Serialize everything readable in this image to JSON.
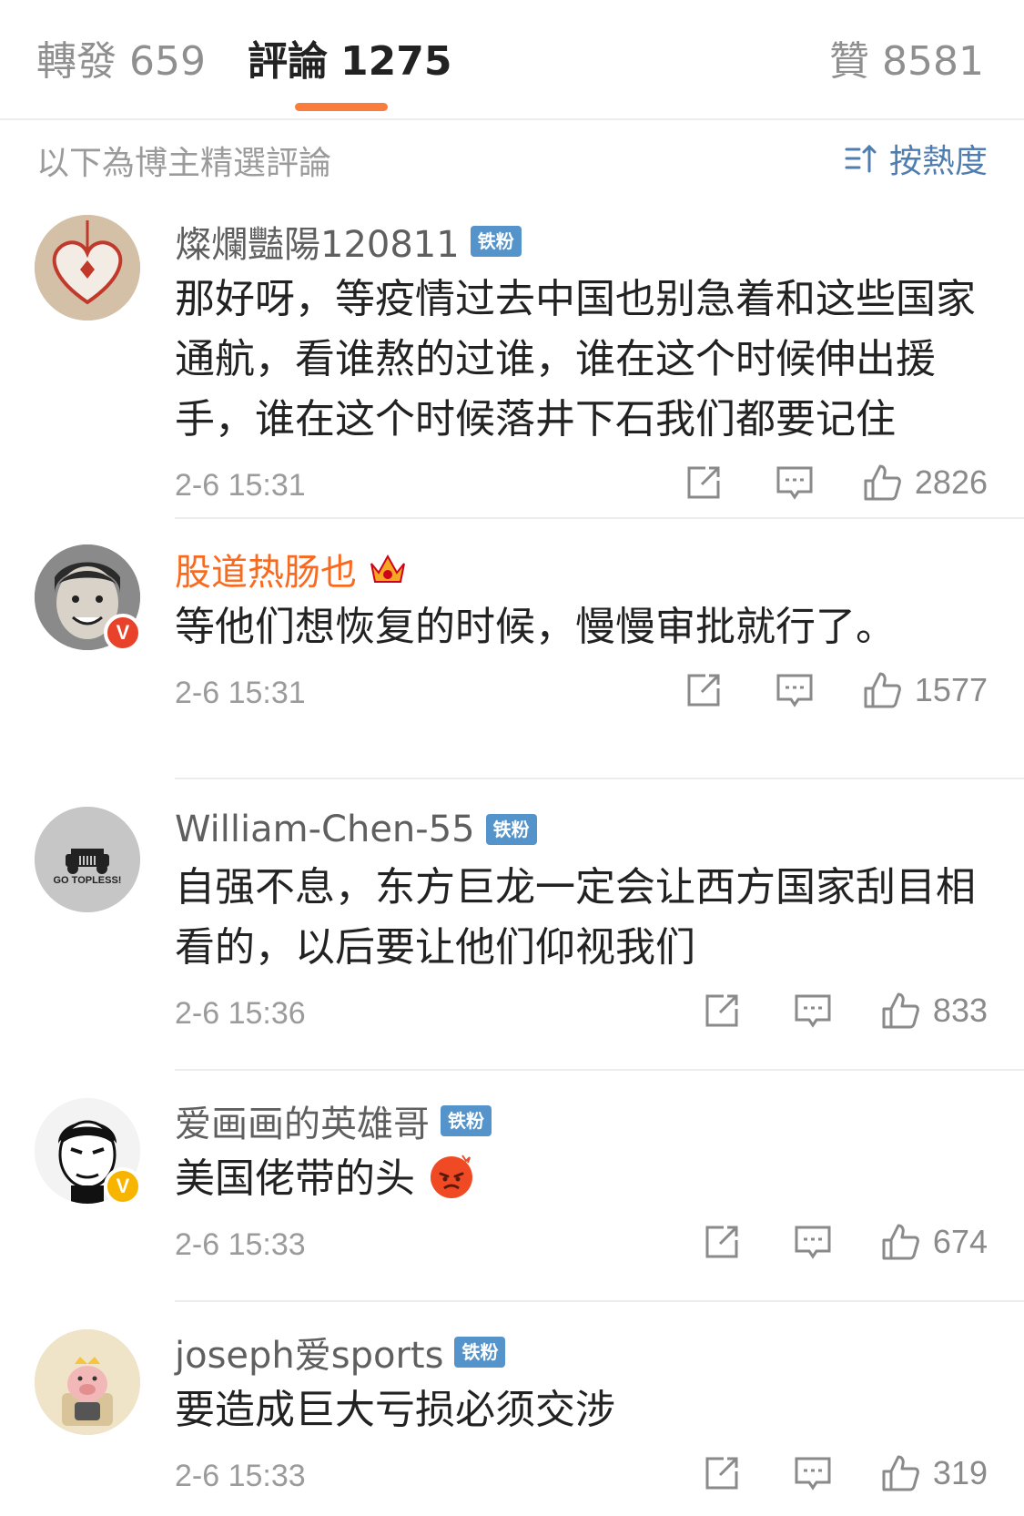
{
  "tabs": {
    "reposts": {
      "label": "轉發",
      "count": "659"
    },
    "comments": {
      "label": "評論",
      "count": "1275"
    },
    "likes": {
      "label": "贊",
      "count": "8581"
    }
  },
  "subheader": {
    "text": "以下為博主精選評論",
    "sort_label": "按熱度"
  },
  "colors": {
    "accent": "#fa7d3c",
    "link": "#507daf",
    "fan_badge": "#5593cb",
    "vip_name": "#f86a1f"
  },
  "comments": [
    {
      "username": "燦爛豔陽120811",
      "badge": "铁粉",
      "text": "那好呀，等疫情过去中国也别急着和这些国家通航，看谁熬的过谁，谁在这个时候伸出援手，谁在这个时候落井下石我们都要记住",
      "time": "2-6 15:31",
      "likes": "2826",
      "avatar_icon": "heart-ornament-avatar"
    },
    {
      "username": "股道热肠也",
      "badge": "",
      "crown_icon": "crown-icon",
      "verified": "V",
      "text": "等他们想恢复的时候，慢慢审批就行了。",
      "time": "2-6 15:31",
      "likes": "1577",
      "avatar_icon": "child-photo-avatar"
    },
    {
      "username": "William-Chen-55",
      "badge": "铁粉",
      "text": "自强不息，东方巨龙一定会让西方国家刮目相看的，以后要让他们仰视我们",
      "time": "2-6 15:36",
      "likes": "833",
      "avatar_icon": "jeep-avatar",
      "avatar_text": "GO TOPLESS!"
    },
    {
      "username": "爱画画的英雄哥",
      "badge": "铁粉",
      "verified": "V",
      "text": "美国佬带的头",
      "emoji": "angry-face-emoji",
      "time": "2-6 15:33",
      "likes": "674",
      "avatar_icon": "cartoon-man-avatar"
    },
    {
      "username": "joseph爱sports",
      "badge": "铁粉",
      "text": "要造成巨大亏损必须交涉",
      "time": "2-6 15:33",
      "likes": "319",
      "avatar_icon": "pig-king-avatar"
    }
  ]
}
